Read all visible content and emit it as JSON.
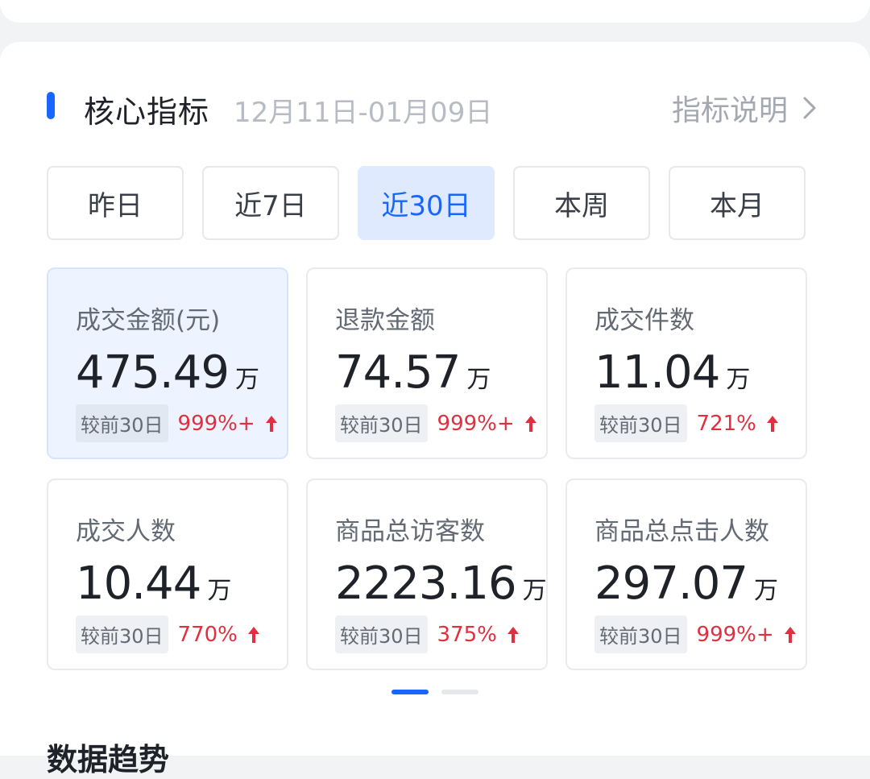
{
  "header": {
    "title": "核心指标",
    "date_range": "12月11日-01月09日",
    "explain_label": "指标说明",
    "accent_color": "#1966ff"
  },
  "tabs": [
    {
      "label": "昨日",
      "active": false
    },
    {
      "label": "近7日",
      "active": false
    },
    {
      "label": "近30日",
      "active": true
    },
    {
      "label": "本周",
      "active": false
    },
    {
      "label": "本月",
      "active": false
    }
  ],
  "metrics": [
    {
      "label": "成交金额(元)",
      "value": "475.49",
      "unit": "万",
      "period": "较前30日",
      "change": "999%+",
      "trend": "up",
      "active": true
    },
    {
      "label": "退款金额",
      "value": "74.57",
      "unit": "万",
      "period": "较前30日",
      "change": "999%+",
      "trend": "up",
      "active": false
    },
    {
      "label": "成交件数",
      "value": "11.04",
      "unit": "万",
      "period": "较前30日",
      "change": "721%",
      "trend": "up",
      "active": false
    },
    {
      "label": "成交人数",
      "value": "10.44",
      "unit": "万",
      "period": "较前30日",
      "change": "770%",
      "trend": "up",
      "active": false
    },
    {
      "label": "商品总访客数",
      "value": "2223.16",
      "unit": "万",
      "period": "较前30日",
      "change": "375%",
      "trend": "up",
      "active": false
    },
    {
      "label": "商品总点击人数",
      "value": "297.07",
      "unit": "万",
      "period": "较前30日",
      "change": "999%+",
      "trend": "up",
      "active": false
    }
  ],
  "pager": {
    "pages": 2,
    "current": 1
  },
  "section": {
    "title": "数据趋势"
  },
  "colors": {
    "up": "#e0303f",
    "active_tab_bg": "#dfeafe"
  }
}
